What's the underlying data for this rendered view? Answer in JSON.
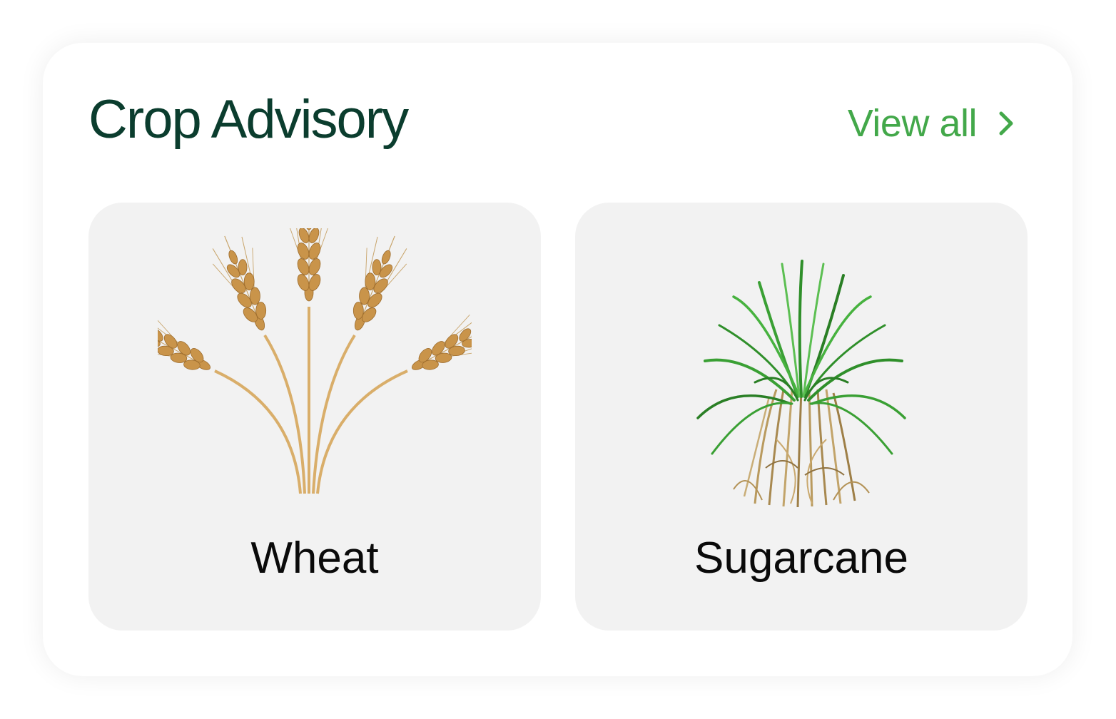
{
  "section": {
    "title": "Crop Advisory",
    "view_all_label": "View all"
  },
  "crops": [
    {
      "name": "Wheat"
    },
    {
      "name": "Sugarcane"
    }
  ],
  "icons": {
    "view_all": "chevron-right-icon",
    "wheat": "wheat-image",
    "sugarcane": "sugarcane-image"
  },
  "colors": {
    "title": "#0b3d2e",
    "accent": "#43a84a",
    "card_bg": "#f2f2f2",
    "wheat_grain": "#c9944a",
    "sugarcane_leaf": "#2f8f2a"
  }
}
